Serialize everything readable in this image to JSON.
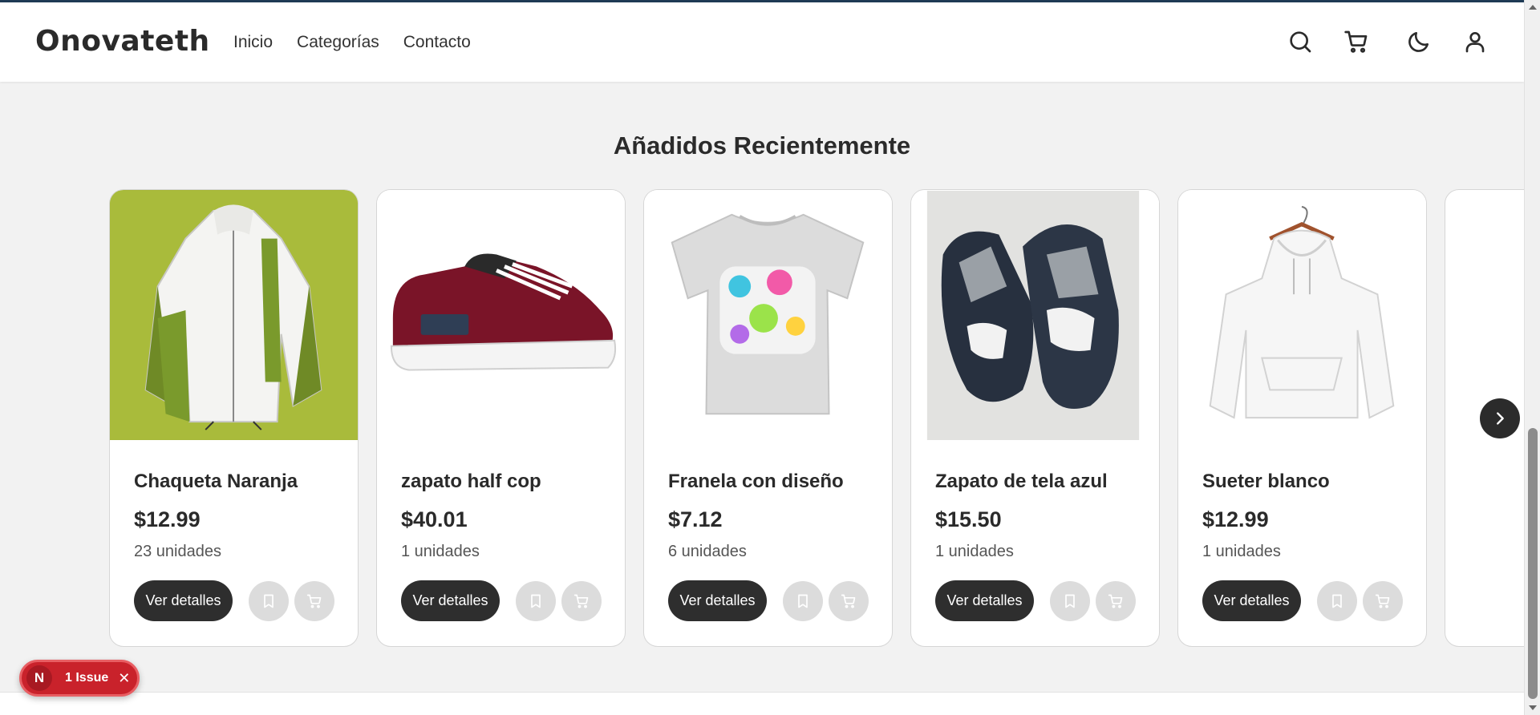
{
  "header": {
    "logo": "Onovateth",
    "nav": [
      "Inicio",
      "Categorías",
      "Contacto"
    ],
    "icons": [
      "search-icon",
      "cart-icon",
      "moon-icon",
      "user-icon"
    ]
  },
  "section": {
    "title": "Añadidos Recientemente"
  },
  "products": [
    {
      "name": "Chaqueta Naranja",
      "price": "$12.99",
      "stock": "23 unidades",
      "details_label": "Ver detalles",
      "image": "green-white-jacket"
    },
    {
      "name": "zapato half cop",
      "price": "$40.01",
      "stock": "1 unidades",
      "details_label": "Ver detalles",
      "image": "maroon-sneaker"
    },
    {
      "name": "Franela con diseño",
      "price": "$7.12",
      "stock": "6 unidades",
      "details_label": "Ver detalles",
      "image": "graphic-tshirt"
    },
    {
      "name": "Zapato de tela azul",
      "price": "$15.50",
      "stock": "1 unidades",
      "details_label": "Ver detalles",
      "image": "navy-sneakers"
    },
    {
      "name": "Sueter blanco",
      "price": "$12.99",
      "stock": "1 unidades",
      "details_label": "Ver detalles",
      "image": "white-hoodie"
    }
  ],
  "issue_badge": {
    "initial": "N",
    "text": "1 Issue"
  },
  "colors": {
    "page_bg": "#f2f2f2",
    "dark_button": "#2e2e2e",
    "issue_red": "#c9222b"
  }
}
